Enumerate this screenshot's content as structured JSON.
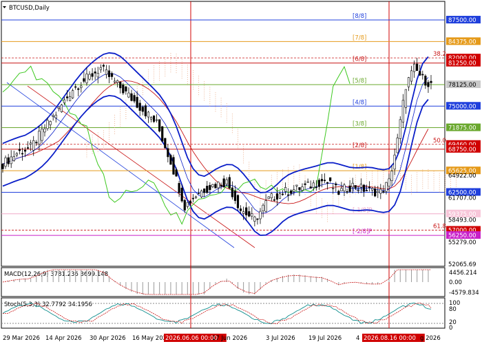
{
  "chart_data": {
    "type": "line",
    "title": "BTCUSD,Daily",
    "xlabel": "",
    "ylabel": "",
    "main": {
      "ylim": [
        52065.69,
        89600
      ],
      "x_dates": [
        "29 Mar 2026",
        "14 Apr 2026",
        "30 Apr 2026",
        "16 May 2026",
        "2026.06.06 00:00",
        "17 Jun 2026",
        "3 Jul 2026",
        "19 Jul 2026",
        "4",
        "2026.08.16 00:00",
        "g 2026"
      ],
      "y_ticks": [
        "87500.00",
        "84375.00",
        "82000.00",
        "81250.00",
        "78125.00",
        "75000.00",
        "71875.00",
        "69460.00",
        "68750.00",
        "65625.00",
        "64922.00",
        "62500.00",
        "61707.00",
        "60000.00",
        "58493.00",
        "57000.00",
        "56250.00",
        "55279.00",
        "52065.69"
      ],
      "price_approx": [
        {
          "d": 0,
          "c": 66600
        },
        {
          "d": 5,
          "c": 68200
        },
        {
          "d": 10,
          "c": 69000
        },
        {
          "d": 15,
          "c": 71800
        },
        {
          "d": 20,
          "c": 74500
        },
        {
          "d": 25,
          "c": 77500
        },
        {
          "d": 30,
          "c": 79000
        },
        {
          "d": 35,
          "c": 80500
        },
        {
          "d": 40,
          "c": 78500
        },
        {
          "d": 45,
          "c": 76500
        },
        {
          "d": 50,
          "c": 74500
        },
        {
          "d": 55,
          "c": 72500
        },
        {
          "d": 60,
          "c": 67000
        },
        {
          "d": 65,
          "c": 60500
        },
        {
          "d": 70,
          "c": 62500
        },
        {
          "d": 75,
          "c": 63500
        },
        {
          "d": 80,
          "c": 64000
        },
        {
          "d": 85,
          "c": 60000
        },
        {
          "d": 90,
          "c": 58500
        },
        {
          "d": 95,
          "c": 61500
        },
        {
          "d": 100,
          "c": 62500
        },
        {
          "d": 105,
          "c": 63000
        },
        {
          "d": 110,
          "c": 63500
        },
        {
          "d": 115,
          "c": 64300
        },
        {
          "d": 120,
          "c": 62500
        },
        {
          "d": 125,
          "c": 63500
        },
        {
          "d": 130,
          "c": 62800
        },
        {
          "d": 135,
          "c": 62500
        },
        {
          "d": 138,
          "c": 64000
        },
        {
          "d": 141,
          "c": 70000
        },
        {
          "d": 144,
          "c": 78000
        },
        {
          "d": 147,
          "c": 80500
        },
        {
          "d": 150,
          "c": 79000
        },
        {
          "d": 153,
          "c": 78100
        }
      ],
      "murrey_levels": [
        {
          "label": "[8/8]",
          "value": 87500,
          "color": "#1f3fdc"
        },
        {
          "label": "[7/8]",
          "value": 84375,
          "color": "#e59a1a"
        },
        {
          "label": "[6/8]",
          "value": 81250,
          "color": "#c81414"
        },
        {
          "label": "[5/8]",
          "value": 78125,
          "color": "#6aa82e"
        },
        {
          "label": "[4/8]",
          "value": 75000,
          "color": "#1f3fdc"
        },
        {
          "label": "[3/8]",
          "value": 71875,
          "color": "#6aa82e"
        },
        {
          "label": "[2/8]",
          "value": 68750,
          "color": "#c81414"
        },
        {
          "label": "[1/8]",
          "value": 65625,
          "color": "#e59a1a"
        },
        {
          "label": "[0/8]",
          "value": 62500,
          "color": "#1f3fdc"
        },
        {
          "label": "[-1/8]P",
          "value": 59375,
          "color": "#f0a8c8"
        },
        {
          "label": "[-2/8]P",
          "value": 56250,
          "color": "#c81fc8"
        }
      ],
      "fib_levels": [
        {
          "label": "38.2",
          "value": 82000
        },
        {
          "label": "50.0",
          "value": 69460
        },
        {
          "label": "61.8",
          "value": 57000
        }
      ],
      "price_boxes": [
        {
          "value": "87500.00",
          "bg": "#1f3fdc",
          "fg": "#ffffff"
        },
        {
          "value": "84375.00",
          "bg": "#e59a1a",
          "fg": "#ffffff"
        },
        {
          "value": "82000.00",
          "bg": "#d00000",
          "fg": "#ffffff"
        },
        {
          "value": "81250.00",
          "bg": "#d00000",
          "fg": "#ffffff"
        },
        {
          "value": "78125.00",
          "bg": "#c8c8c8",
          "fg": "#000000"
        },
        {
          "value": "75000.00",
          "bg": "#1f3fdc",
          "fg": "#ffffff"
        },
        {
          "value": "71875.00",
          "bg": "#6aa82e",
          "fg": "#ffffff"
        },
        {
          "value": "69460.00",
          "bg": "#d00000",
          "fg": "#ffffff"
        },
        {
          "value": "68750.00",
          "bg": "#d00000",
          "fg": "#ffffff"
        },
        {
          "value": "65625.00",
          "bg": "#e59a1a",
          "fg": "#ffffff"
        },
        {
          "value": "62500.00",
          "bg": "#1f3fdc",
          "fg": "#ffffff"
        },
        {
          "value": "59375.00",
          "bg": "#f7c6d9",
          "fg": "#ffffff"
        },
        {
          "value": "57000.00",
          "bg": "#d00000",
          "fg": "#ffffff"
        },
        {
          "value": "56250.00",
          "bg": "#c81fc8",
          "fg": "#ffffff"
        }
      ],
      "plain_ticks": [
        {
          "value": "64922.00",
          "v": 64922
        },
        {
          "value": "61707.00",
          "v": 61707
        },
        {
          "value": "58493.00",
          "v": 58493
        },
        {
          "value": "55279.00",
          "v": 55279
        },
        {
          "value": "52065.69",
          "v": 52065.69
        }
      ]
    },
    "macd": {
      "label": "MACD(12,26,9) 3781.236 3699.148",
      "y_ticks": [
        "4456.214",
        "0.00",
        "-4579.834"
      ],
      "ylim": [
        -4579.834,
        4456.214
      ]
    },
    "stoch": {
      "label": "Stoch(5,3,3) 32.7792 34.1956",
      "y_ticks": [
        "100",
        "80",
        "20",
        "0"
      ],
      "ylim": [
        0,
        100
      ]
    },
    "legend": "none",
    "grid": false
  },
  "colors": {
    "candles": "#000000",
    "ma_red": "#c81414",
    "bands_blue": "#0a1ec8",
    "chikou_green": "#3cc81e",
    "cloud": "#e8a078",
    "stoch_main": "#0a8c8c",
    "stoch_signal": "#c81414"
  }
}
